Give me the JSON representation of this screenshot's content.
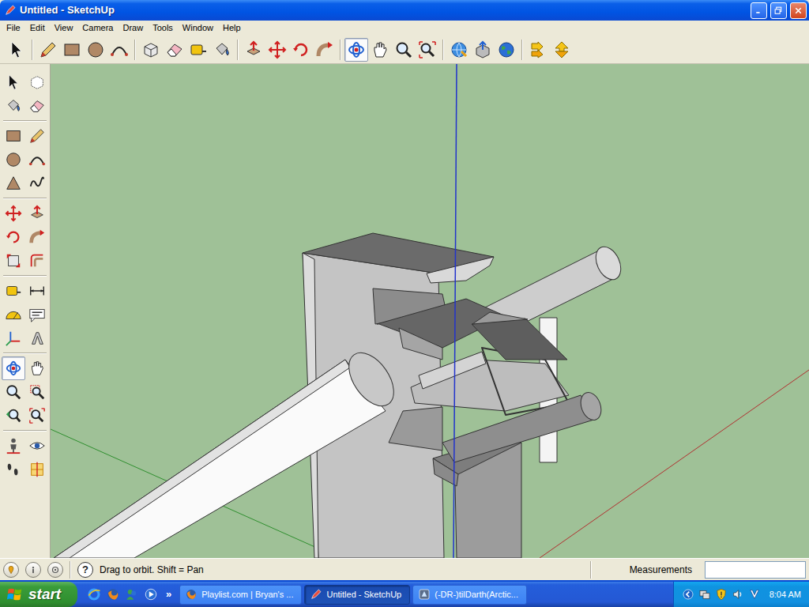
{
  "window": {
    "title": "Untitled - SketchUp"
  },
  "menus": [
    "File",
    "Edit",
    "View",
    "Camera",
    "Draw",
    "Tools",
    "Window",
    "Help"
  ],
  "toolbar": {
    "groups": [
      [
        {
          "selected": false
        }
      ],
      [
        {
          "selected": false
        },
        {
          "selected": false
        },
        {
          "selected": false
        },
        {
          "selected": false
        }
      ],
      [
        {
          "selected": false
        },
        {
          "selected": false
        },
        {
          "selected": false
        },
        {
          "selected": false
        }
      ],
      [
        {
          "selected": false
        },
        {
          "selected": false
        },
        {
          "selected": false
        },
        {
          "selected": false
        }
      ],
      [
        {
          "selected": true
        },
        {
          "selected": false
        },
        {
          "selected": false
        },
        {
          "selected": false
        }
      ],
      [
        {
          "selected": false
        },
        {
          "selected": false
        },
        {
          "selected": false
        }
      ],
      [
        {
          "selected": false
        },
        {
          "selected": false
        }
      ]
    ]
  },
  "side_toolbar": {
    "groups": [
      [
        {
          "selected": false
        },
        {
          "selected": false
        },
        {
          "selected": false
        },
        {
          "selected": false
        }
      ],
      [
        {
          "selected": false
        },
        {
          "selected": false
        },
        {
          "selected": false
        },
        {
          "selected": false
        },
        {
          "selected": false
        },
        {
          "selected": false
        }
      ],
      [
        {
          "selected": false
        },
        {
          "selected": false
        },
        {
          "selected": false
        },
        {
          "selected": false
        },
        {
          "selected": false
        },
        {
          "selected": false
        }
      ],
      [
        {
          "selected": false
        },
        {
          "selected": false
        },
        {
          "selected": false
        },
        {
          "selected": false
        },
        {
          "selected": false
        },
        {
          "selected": false
        }
      ],
      [
        {
          "selected": true
        },
        {
          "selected": false
        },
        {
          "selected": false
        },
        {
          "selected": false
        },
        {
          "selected": false
        },
        {
          "selected": false
        }
      ],
      [
        {
          "selected": false
        },
        {
          "selected": false
        },
        {
          "selected": false
        },
        {
          "selected": false
        }
      ]
    ]
  },
  "status_bar": {
    "help": "?",
    "hint": "Drag to orbit. Shift = Pan",
    "measurements_label": "Measurements",
    "measurements_value": ""
  },
  "taskbar": {
    "start": "start",
    "more": "»",
    "tasks": [
      {
        "label": "Playlist.com | Bryan's ...",
        "selected": false
      },
      {
        "label": "Untitled - SketchUp",
        "selected": true
      },
      {
        "label": "(-DR-)tilDarth(Arctic...",
        "selected": false
      }
    ],
    "clock": "8:04 AM"
  }
}
